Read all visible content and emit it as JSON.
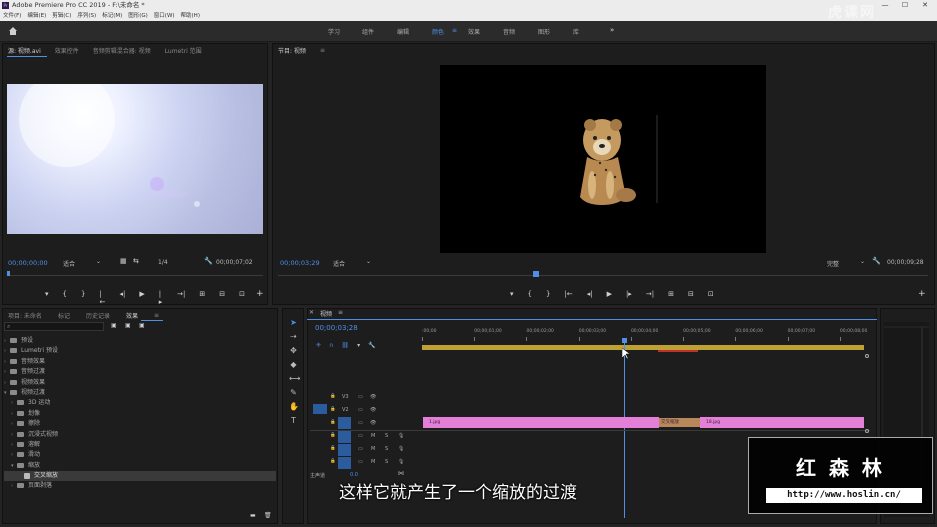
{
  "window": {
    "title": "Adobe Premiere Pro CC 2019 - F:\\未命名 *",
    "min": "—",
    "max": "☐",
    "close": "✕"
  },
  "menu": [
    "文件(F)",
    "编辑(E)",
    "剪辑(C)",
    "序列(S)",
    "标记(M)",
    "图形(G)",
    "窗口(W)",
    "帮助(H)"
  ],
  "workspaces": {
    "home_icon": "home-icon",
    "items": [
      "学习",
      "组件",
      "编辑",
      "颜色",
      "效果",
      "音频",
      "图形",
      "库"
    ],
    "active": "颜色",
    "overflow": "»"
  },
  "watermark": "虎课网",
  "source": {
    "tabs": [
      "源: 视频.avi",
      "效果控件",
      "音频剪辑混合器: 视频",
      "Lumetri 范围"
    ],
    "menu_icon": "≡",
    "timecode_left": "00;00;00;00",
    "fit": "适合",
    "fraction": "1/4",
    "timecode_right": "00;00;07;02"
  },
  "program": {
    "title": "节目: 视频",
    "menu_icon": "≡",
    "timecode_left": "00;00;03;29",
    "fit": "适合",
    "quality": "完整",
    "timecode_right": "00;00;09;28"
  },
  "transport": [
    "▾",
    "{",
    "}",
    "|←",
    "◂|",
    "▶",
    "|▸",
    "→|",
    "⊞",
    "⊟",
    "⊡"
  ],
  "project": {
    "tabs": [
      "项目: 未命名",
      "标记",
      "历史记录",
      "效果"
    ],
    "active_tab": "效果",
    "tree": [
      {
        "label": "预设",
        "level": 0,
        "expanded": false
      },
      {
        "label": "Lumetri 预设",
        "level": 0,
        "expanded": false
      },
      {
        "label": "音频效果",
        "level": 0,
        "expanded": false
      },
      {
        "label": "音频过渡",
        "level": 0,
        "expanded": false
      },
      {
        "label": "视频效果",
        "level": 0,
        "expanded": false
      },
      {
        "label": "视频过渡",
        "level": 0,
        "expanded": true
      },
      {
        "label": "3D 运动",
        "level": 1,
        "expanded": false
      },
      {
        "label": "划像",
        "level": 1,
        "expanded": false
      },
      {
        "label": "擦除",
        "level": 1,
        "expanded": false
      },
      {
        "label": "沉浸式视频",
        "level": 1,
        "expanded": false
      },
      {
        "label": "溶解",
        "level": 1,
        "expanded": false
      },
      {
        "label": "滑动",
        "level": 1,
        "expanded": false
      },
      {
        "label": "缩放",
        "level": 1,
        "expanded": true
      },
      {
        "label": "交叉缩放",
        "level": 2,
        "expanded": false,
        "selected": true
      },
      {
        "label": "页面剥落",
        "level": 1,
        "expanded": false
      }
    ]
  },
  "timeline": {
    "title": "视频",
    "menu_icon": "≡",
    "timecode": "00;00;03;28",
    "ruler": [
      ":00;00",
      "00;00;01;00",
      "00;00;02;00",
      "00;00;03;00",
      "00;00;04;00",
      "00;00;05;00",
      "00;00;06;00",
      "00;00;07;00",
      "00;00;08;00"
    ],
    "video_tracks": [
      "V3",
      "V2",
      "V1"
    ],
    "audio_tracks": [
      "A1",
      "A2",
      "A3"
    ],
    "master": "主声道",
    "master_value": "0.0",
    "clips": [
      {
        "label": "1.jpg",
        "track": "V1"
      },
      {
        "label": "交叉缩放",
        "track": "V1"
      },
      {
        "label": "18.jpg",
        "track": "V1"
      }
    ]
  },
  "subtitle": "这样它就产生了一个缩放的过渡",
  "brand": {
    "name": "红 森 林",
    "url": "http://www.hoslin.cn/"
  },
  "colors": {
    "accent": "#4f8fe8",
    "clip": "#e37fd6",
    "transition": "#b9885a"
  }
}
